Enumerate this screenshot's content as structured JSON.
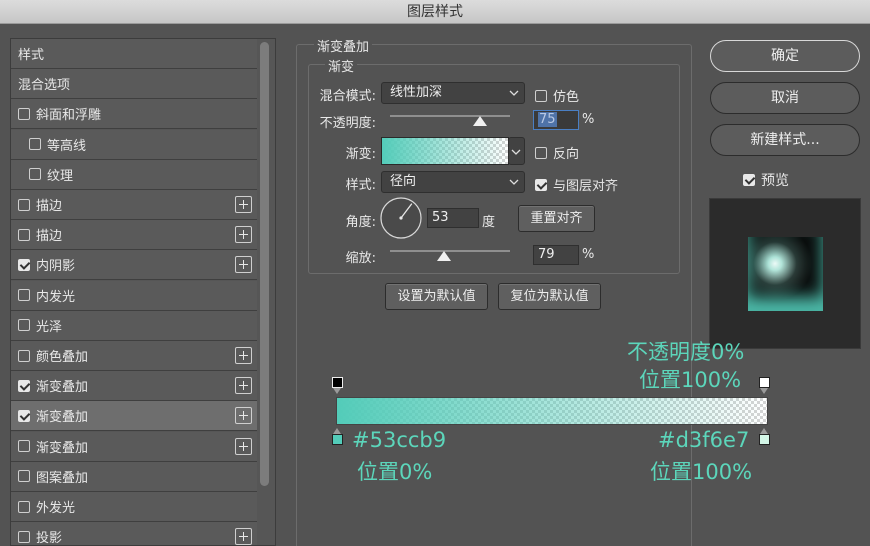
{
  "window": {
    "title": "图层样式"
  },
  "sidebar": {
    "items": [
      {
        "label": "样式",
        "checkbox": false,
        "checked": false,
        "plus": false
      },
      {
        "label": "混合选项",
        "checkbox": false,
        "checked": false,
        "plus": false
      },
      {
        "label": "斜面和浮雕",
        "checkbox": true,
        "checked": false,
        "plus": false
      },
      {
        "label": "等高线",
        "checkbox": true,
        "checked": false,
        "plus": false,
        "indent": true
      },
      {
        "label": "纹理",
        "checkbox": true,
        "checked": false,
        "plus": false,
        "indent": true
      },
      {
        "label": "描边",
        "checkbox": true,
        "checked": false,
        "plus": true
      },
      {
        "label": "描边",
        "checkbox": true,
        "checked": false,
        "plus": true
      },
      {
        "label": "内阴影",
        "checkbox": true,
        "checked": true,
        "plus": true
      },
      {
        "label": "内发光",
        "checkbox": true,
        "checked": false,
        "plus": false
      },
      {
        "label": "光泽",
        "checkbox": true,
        "checked": false,
        "plus": false
      },
      {
        "label": "颜色叠加",
        "checkbox": true,
        "checked": false,
        "plus": true
      },
      {
        "label": "渐变叠加",
        "checkbox": true,
        "checked": true,
        "plus": true
      },
      {
        "label": "渐变叠加",
        "checkbox": true,
        "checked": true,
        "plus": true,
        "selected": true
      },
      {
        "label": "渐变叠加",
        "checkbox": true,
        "checked": false,
        "plus": true
      },
      {
        "label": "图案叠加",
        "checkbox": true,
        "checked": false,
        "plus": false
      },
      {
        "label": "外发光",
        "checkbox": true,
        "checked": false,
        "plus": false
      },
      {
        "label": "投影",
        "checkbox": true,
        "checked": false,
        "plus": true
      }
    ]
  },
  "panel": {
    "group_title": "渐变叠加",
    "subgroup_title": "渐变",
    "blend_mode_label": "混合模式:",
    "blend_mode_value": "线性加深",
    "dither_label": "仿色",
    "dither_checked": false,
    "opacity_label": "不透明度:",
    "opacity_value": "75",
    "opacity_unit": "%",
    "gradient_label": "渐变:",
    "reverse_label": "反向",
    "reverse_checked": false,
    "style_label": "样式:",
    "style_value": "径向",
    "align_label": "与图层对齐",
    "align_checked": true,
    "angle_label": "角度:",
    "angle_value": "53",
    "angle_unit": "度",
    "reset_align_label": "重置对齐",
    "scale_label": "缩放:",
    "scale_value": "79",
    "scale_unit": "%",
    "set_default_label": "设置为默认值",
    "reset_default_label": "复位为默认值"
  },
  "actions": {
    "ok_label": "确定",
    "cancel_label": "取消",
    "new_style_label": "新建样式...",
    "preview_label": "预览",
    "preview_checked": true
  },
  "gradient_editor": {
    "start_color": "#53ccb9",
    "end_color": "#d3f6e7",
    "end_opacity_note": "不透明度0%",
    "end_opacity_position_note": "位置100%",
    "start_color_note": "#53ccb9",
    "start_position_note": "位置0%",
    "end_color_note": "#d3f6e7",
    "end_position_note": "位置100%"
  }
}
